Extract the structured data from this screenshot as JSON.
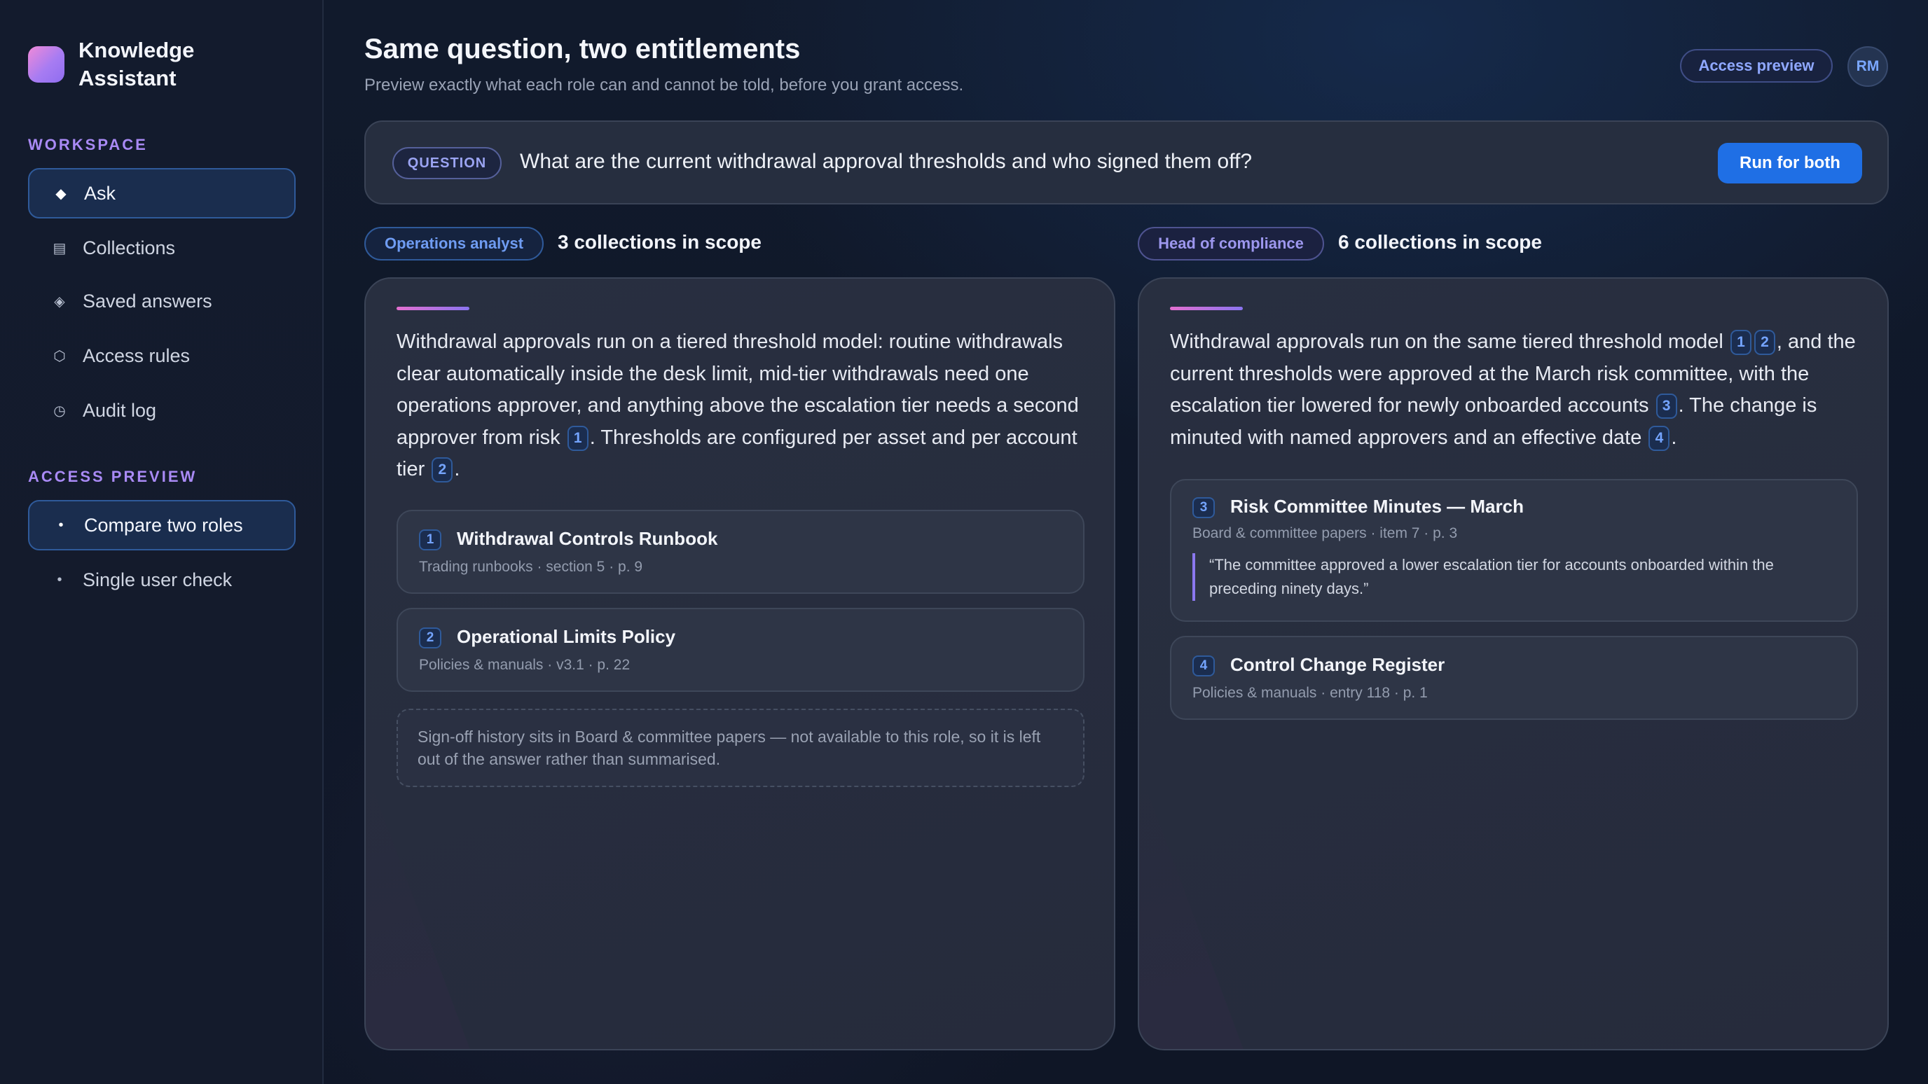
{
  "sidebar": {
    "brand_line1": "Knowledge",
    "brand_line2": "Assistant",
    "workspace_label": "WORKSPACE",
    "workspace_items": [
      {
        "label": "Ask",
        "icon": "diamond-icon",
        "active": true
      },
      {
        "label": "Collections",
        "icon": "stack-icon",
        "active": false
      },
      {
        "label": "Saved answers",
        "icon": "bookmark-diamond-icon",
        "active": false
      },
      {
        "label": "Access rules",
        "icon": "hexagon-icon",
        "active": false
      },
      {
        "label": "Audit log",
        "icon": "clock-icon",
        "active": false
      }
    ],
    "preview_label": "ACCESS PREVIEW",
    "preview_items": [
      {
        "label": "Compare two roles",
        "icon": "dot-icon",
        "active": true
      },
      {
        "label": "Single user check",
        "icon": "dot-icon",
        "active": false
      }
    ]
  },
  "header": {
    "title": "Same question, two entitlements",
    "subtitle": "Preview exactly what each role can and cannot be told, before you grant access.",
    "access_preview": "Access preview",
    "avatar_initials": "RM"
  },
  "question": {
    "tag": "QUESTION",
    "text": "What are the current withdrawal approval thresholds and who signed them off?",
    "run_label": "Run for both"
  },
  "left": {
    "role": "Operations analyst",
    "scope": "3 collections in scope",
    "answer": {
      "p1": "Withdrawal approvals run on a tiered threshold model: routine withdrawals clear automatically inside the desk limit, mid-tier withdrawals need one operations approver, and anything above the escalation tier needs a second approver from risk",
      "c1": "1",
      "p2": ". Thresholds are configured per asset and per account tier",
      "c2": "2",
      "p3": "."
    },
    "sources": [
      {
        "num": "1",
        "title": "Withdrawal Controls Runbook",
        "meta": "Trading runbooks · section 5 · p. 9"
      },
      {
        "num": "2",
        "title": "Operational Limits Policy",
        "meta": "Policies & manuals · v3.1 · p. 22"
      }
    ],
    "note": "Sign-off history sits in Board & committee papers — not available to this role, so it is left out of the answer rather than summarised."
  },
  "right": {
    "role": "Head of compliance",
    "scope": "6 collections in scope",
    "answer": {
      "p1": "Withdrawal approvals run on the same tiered threshold model",
      "c1": "1",
      "c2": "2",
      "p2": ", and the current thresholds were approved at the March risk committee, with the escalation tier lowered for newly onboarded accounts",
      "c3": "3",
      "p3": ". The change is minuted with named approvers and an effective date",
      "c4": "4",
      "p4": "."
    },
    "sources": [
      {
        "num": "3",
        "title": "Risk Committee Minutes — March",
        "meta": "Board & committee papers · item 7 · p. 3",
        "quote": "“The committee approved a lower escalation tier for accounts onboarded within the preceding ninety days.”"
      },
      {
        "num": "4",
        "title": "Control Change Register",
        "meta": "Policies & manuals · entry 118 · p. 1"
      }
    ]
  },
  "colors": {
    "accent_blue": "#1f6fe5",
    "accent_purple": "#a98af5",
    "panel_bg": "#282f40"
  }
}
